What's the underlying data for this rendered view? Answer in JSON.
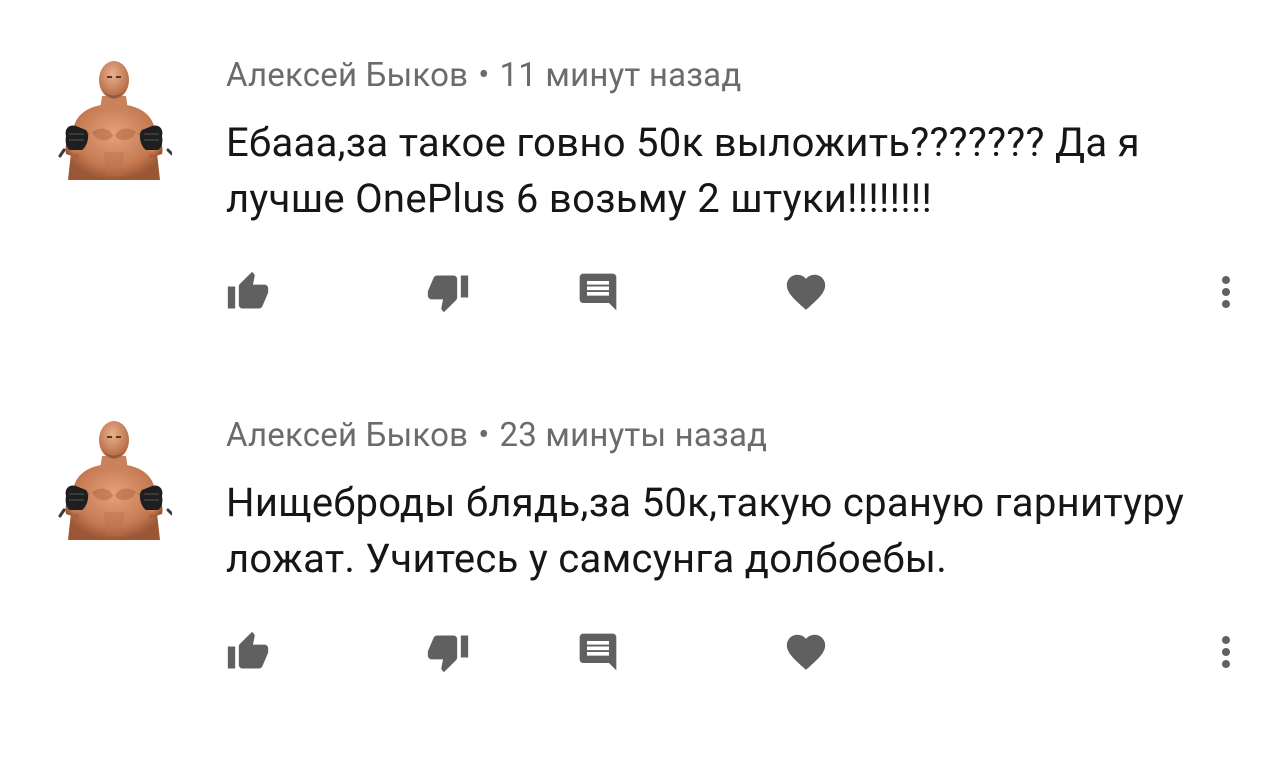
{
  "comments": [
    {
      "author": "Алексей Быков",
      "separator": "•",
      "time": "11 минут назад",
      "text": "Ебааа,за такое говно 50к выложить??????? Да я лучше OnePlus 6 возьму 2 штуки!!!!!!!!",
      "actions": [
        "thumbs-up-icon",
        "thumbs-down-icon",
        "reply-icon",
        "heart-icon",
        "more-vert-icon"
      ]
    },
    {
      "author": "Алексей Быков",
      "separator": "•",
      "time": "23 минуты назад",
      "text": "Нищеброды блядь,за 50к,такую сраную гарнитуру ложат. Учитесь у самсунга долбоебы.",
      "actions": [
        "thumbs-up-icon",
        "thumbs-down-icon",
        "reply-icon",
        "heart-icon",
        "more-vert-icon"
      ]
    }
  ],
  "colors": {
    "icon": "#606060",
    "meta": "#6b6b6b",
    "text": "#161616",
    "background": "#ffffff"
  }
}
